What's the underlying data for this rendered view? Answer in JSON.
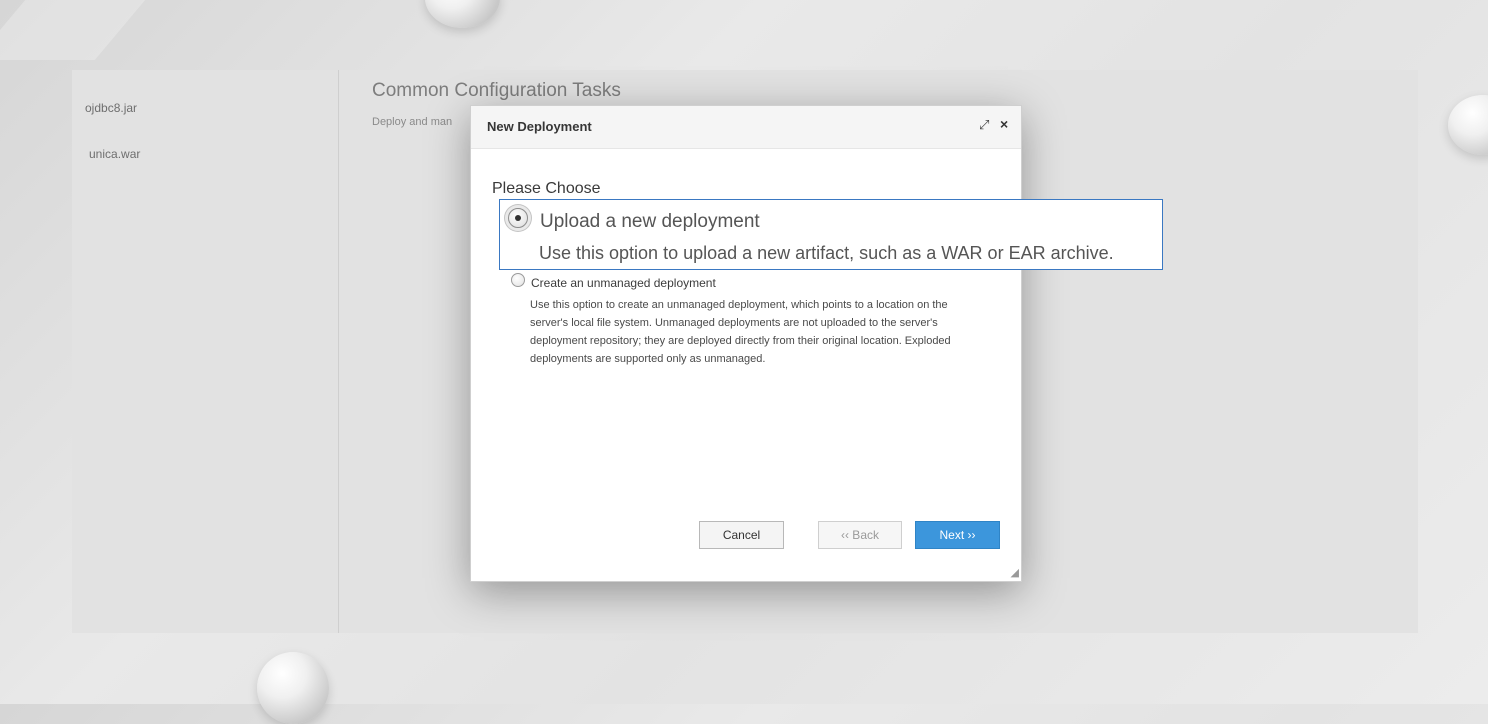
{
  "sidebar": {
    "items": [
      {
        "label": "ojdbc8.jar"
      },
      {
        "label": "unica.war"
      }
    ]
  },
  "main": {
    "title": "Common Configuration Tasks",
    "subtitle": "Deploy and man"
  },
  "dialog": {
    "title": "New Deployment",
    "heading": "Please Choose",
    "options": [
      {
        "label": "Upload a new deployment",
        "description": "Use this option to upload a new artifact, such as a WAR or EAR archive.",
        "selected": true
      },
      {
        "label": "Create an unmanaged deployment",
        "description": "Use this option to create an unmanaged deployment, which points to a location on the server's local file system. Unmanaged deployments are not uploaded to the server's deployment repository; they are deployed directly from their original location. Exploded deployments are supported only as unmanaged.",
        "selected": false
      }
    ],
    "buttons": {
      "cancel": "Cancel",
      "back": "‹‹ Back",
      "next": "Next ››"
    }
  },
  "colors": {
    "accent": "#3c96dc",
    "callout_border": "#3a78c2"
  }
}
